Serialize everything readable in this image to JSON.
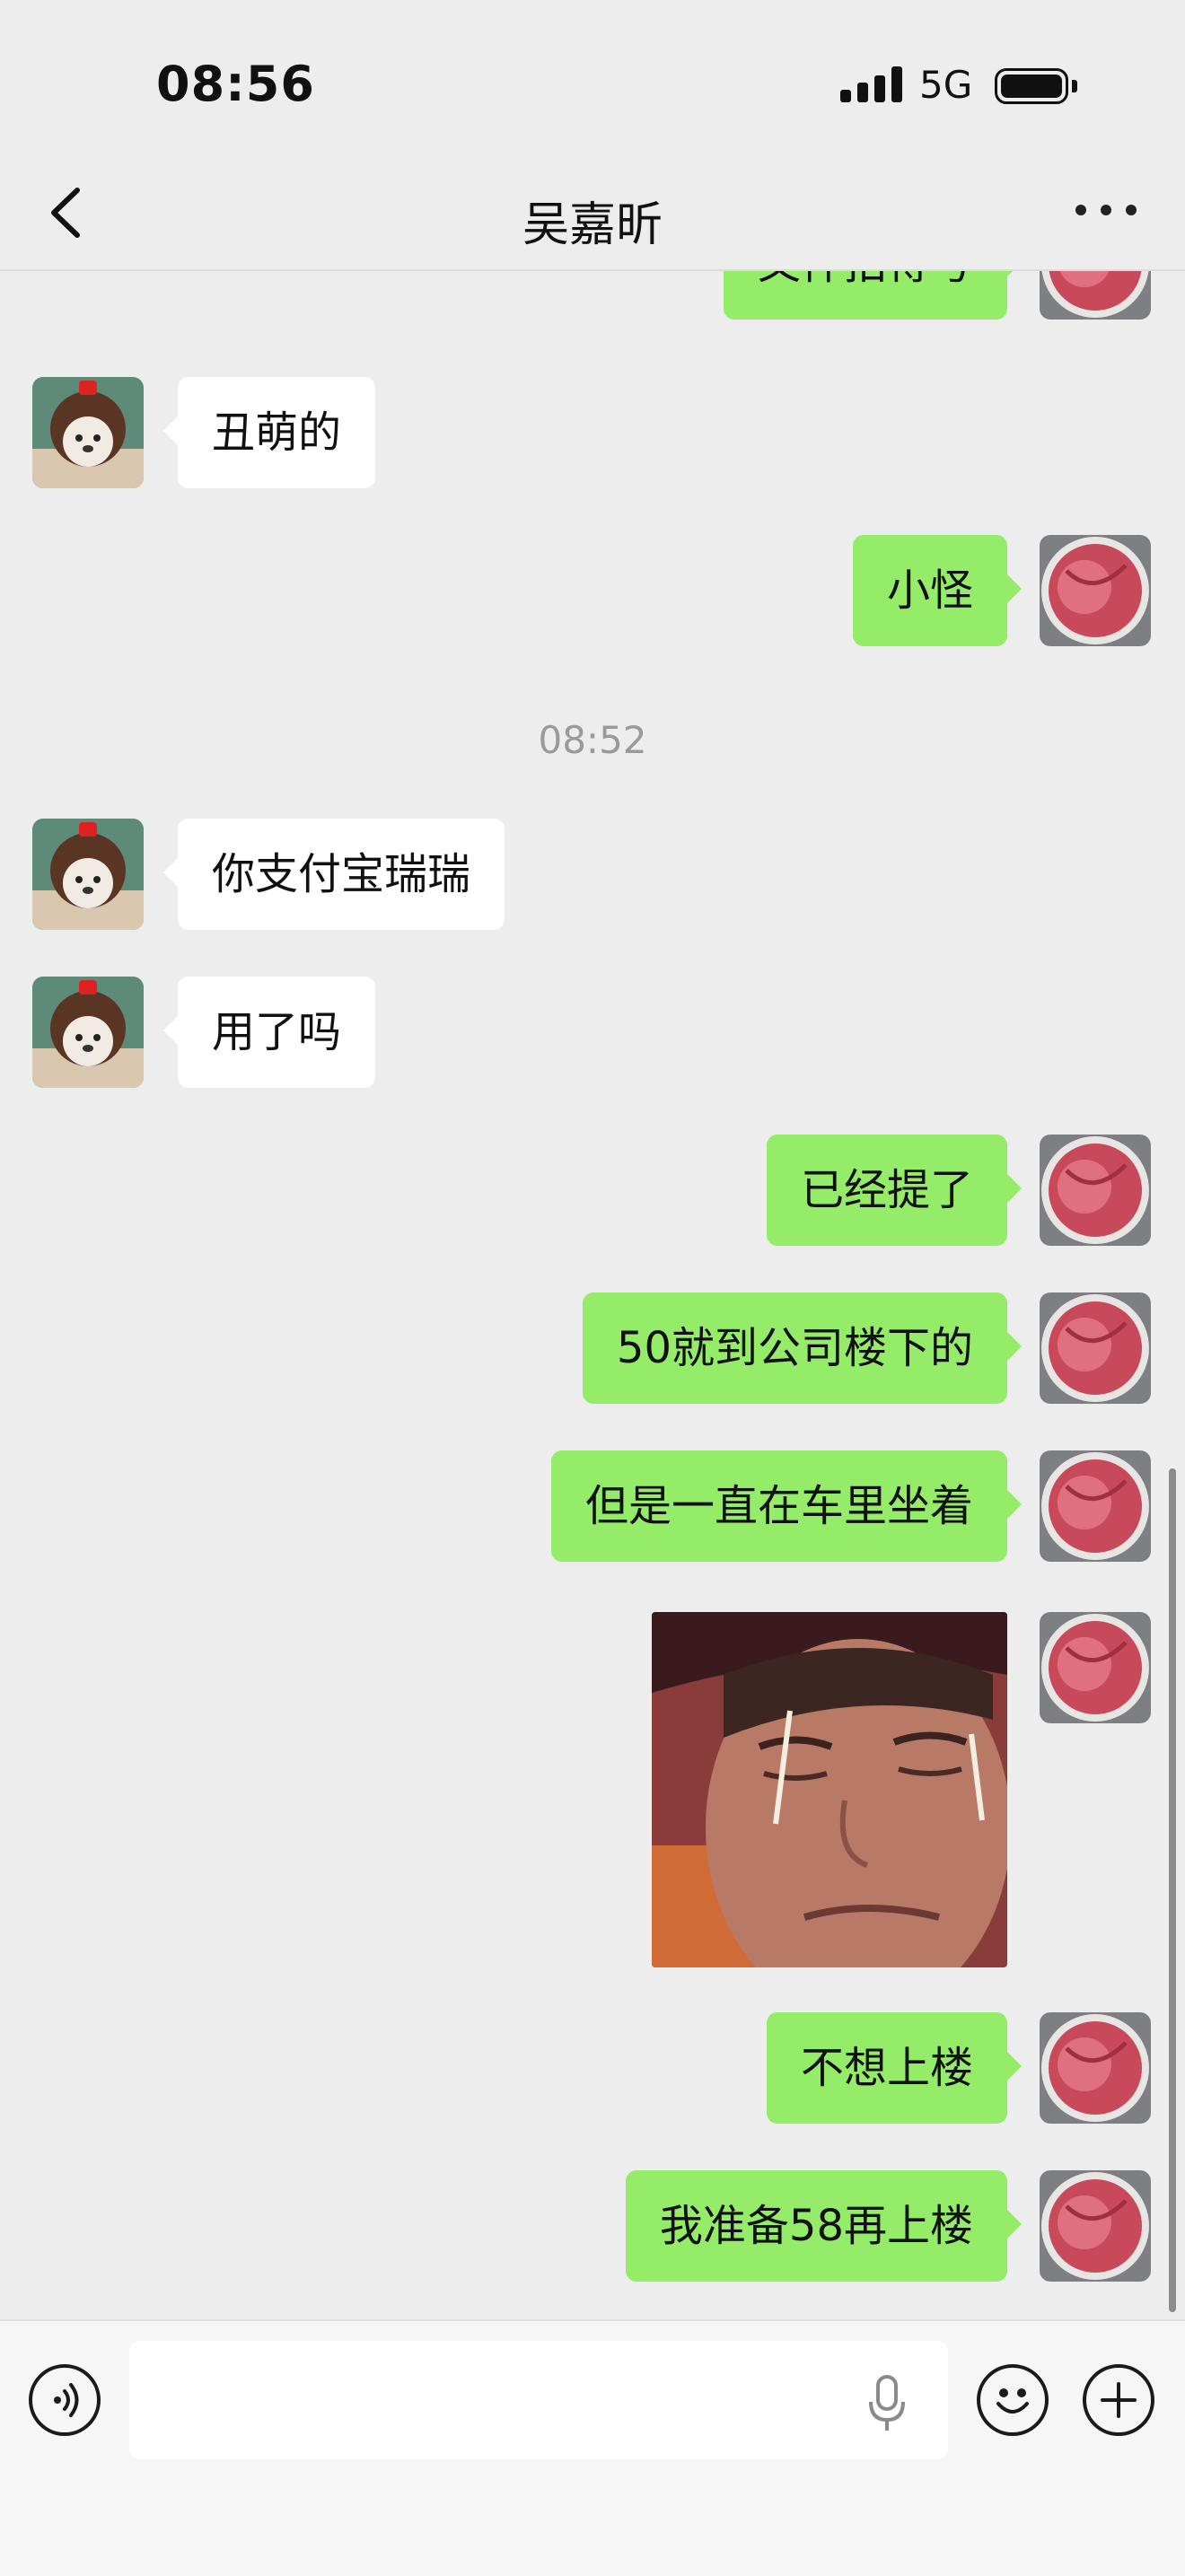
{
  "status_bar": {
    "time": "08:56",
    "network": "5G"
  },
  "header": {
    "title": "吴嘉昕"
  },
  "messages": [
    {
      "sender": "self",
      "text": "文件拍得号"
    },
    {
      "sender": "other",
      "text": "丑萌的"
    },
    {
      "sender": "self",
      "text": "小怪"
    },
    {
      "type": "time",
      "text": "08:52"
    },
    {
      "sender": "other",
      "text": "你支付宝瑞瑞"
    },
    {
      "sender": "other",
      "text": "用了吗"
    },
    {
      "sender": "self",
      "text": "已经提了"
    },
    {
      "sender": "self",
      "text": "50就到公司楼下的"
    },
    {
      "sender": "self",
      "text": "但是一直在车里坐着"
    },
    {
      "sender": "self",
      "type": "image"
    },
    {
      "sender": "self",
      "text": "不想上楼"
    },
    {
      "sender": "self",
      "text": "我准备58再上楼"
    }
  ],
  "input": {
    "placeholder": ""
  },
  "colors": {
    "self_bubble": "#95ec69",
    "other_bubble": "#ffffff",
    "background": "#ededed"
  },
  "icons": [
    "back-icon",
    "more-icon",
    "voice-icon",
    "mic-icon",
    "emoji-icon",
    "add-icon"
  ]
}
